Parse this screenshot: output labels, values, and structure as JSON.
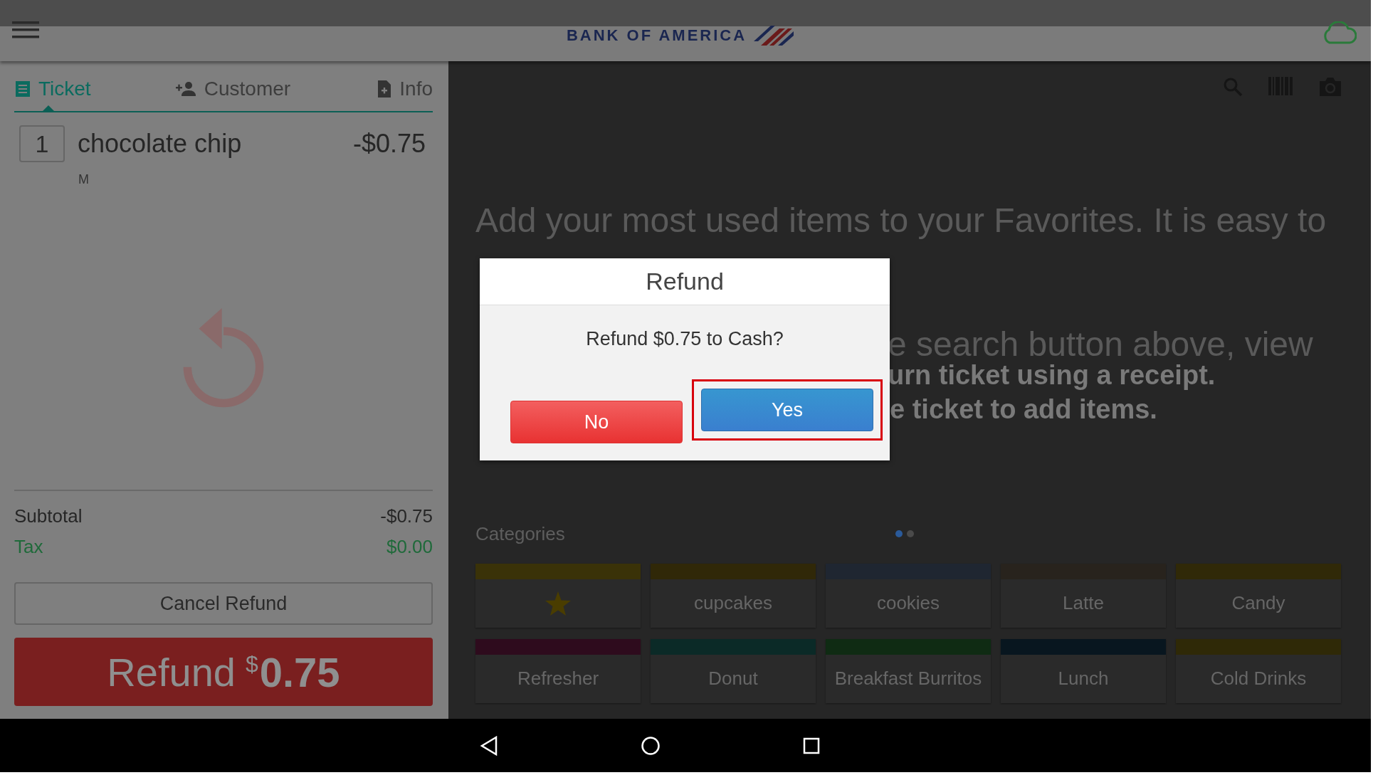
{
  "top_bar": {
    "logo_text": "BANK OF AMERICA"
  },
  "ticket_panel": {
    "tabs": [
      {
        "label": "Ticket",
        "kind": "ticket",
        "selected": true
      },
      {
        "label": "Customer",
        "kind": "customer",
        "selected": false
      },
      {
        "label": "Info",
        "kind": "info",
        "selected": false
      }
    ],
    "items": [
      {
        "quantity": "1",
        "name": "chocolate chip",
        "price": "-$0.75",
        "modifier": "M"
      }
    ],
    "totals": [
      {
        "label": "Subtotal",
        "value": "-$0.75",
        "kind": "subtotal"
      },
      {
        "label": "Tax",
        "value": "$0.00",
        "kind": "tax"
      }
    ],
    "cancel_button": "Cancel Refund",
    "refund_button": {
      "label": "Refund",
      "currency": "$",
      "amount": "0.75"
    }
  },
  "main": {
    "intro_text": "Add your most used items to your Favorites. It is easy to",
    "peek_texts": [
      {
        "text": "e search button above, view",
        "kind": "light"
      },
      {
        "text": "urn ticket using a receipt.",
        "kind": "bold"
      },
      {
        "text": "e ticket to add items.",
        "kind": "bold"
      }
    ],
    "categories": {
      "title": "Categories",
      "pages": [
        {
          "selected": true
        },
        {
          "selected": false
        }
      ],
      "tiles": [
        {
          "kind": "favorites",
          "color": "#3a3208"
        },
        {
          "kind": "category",
          "label": "cupcakes",
          "color": "#302808"
        },
        {
          "kind": "category",
          "label": "cookies",
          "color": "#1f2631"
        },
        {
          "kind": "category",
          "label": "Latte",
          "color": "#28231d"
        },
        {
          "kind": "category",
          "label": "Candy",
          "color": "#302908"
        },
        {
          "kind": "category",
          "label": "Refresher",
          "color": "#2e0b1d"
        },
        {
          "kind": "category",
          "label": "Donut",
          "color": "#0b2a27"
        },
        {
          "kind": "category",
          "label": "Breakfast Burritos",
          "color": "#0f2b13"
        },
        {
          "kind": "category",
          "label": "Lunch",
          "color": "#08161f"
        },
        {
          "kind": "category",
          "label": "Cold Drinks",
          "color": "#2f2907"
        }
      ]
    }
  },
  "dialog": {
    "title": "Refund",
    "message": "Refund $0.75 to Cash?",
    "buttons": [
      {
        "label": "No",
        "kind": "cancel",
        "highlighted": false
      },
      {
        "label": "Yes",
        "kind": "confirm",
        "highlighted": true
      }
    ]
  }
}
